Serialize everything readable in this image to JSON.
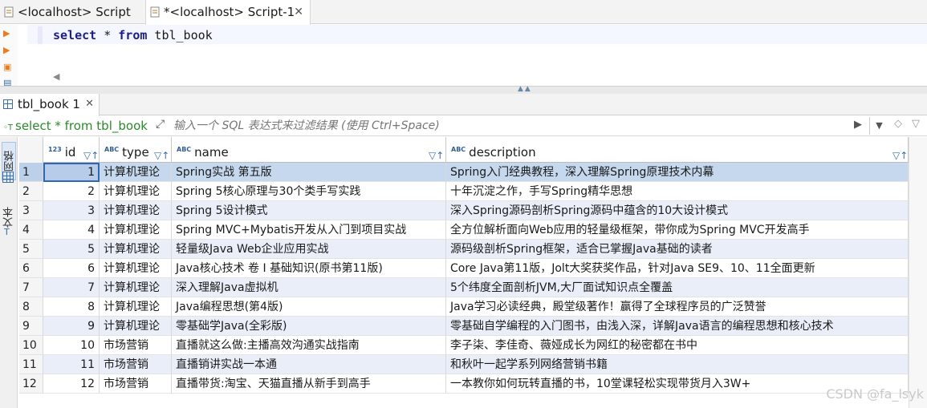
{
  "editor_tabs": [
    {
      "label": "<localhost> Script"
    },
    {
      "label": "*<localhost> Script-1",
      "close": "✕"
    }
  ],
  "editor": {
    "keyword_select": "select",
    "star": " * ",
    "keyword_from": "from",
    "table": " tbl_book"
  },
  "result_tab": {
    "label": "tbl_book 1",
    "close": "✕"
  },
  "filter": {
    "query": "select * from tbl_book",
    "placeholder": "输入一个 SQL 表达式来过滤结果 (使用 Ctrl+Space)"
  },
  "side_panel": {
    "grid_label": "网格",
    "text_label": "文本"
  },
  "columns": [
    {
      "label": "id",
      "type_icon": "123"
    },
    {
      "label": "type",
      "type_icon": "ABC"
    },
    {
      "label": "name",
      "type_icon": "ABC"
    },
    {
      "label": "description",
      "type_icon": "ABC"
    }
  ],
  "rows": [
    {
      "rn": "1",
      "id": "1",
      "type": "计算机理论",
      "name": "Spring实战 第五版",
      "description": "Spring入门经典教程，深入理解Spring原理技术内幕"
    },
    {
      "rn": "2",
      "id": "2",
      "type": "计算机理论",
      "name": "Spring 5核心原理与30个类手写实践",
      "description": "十年沉淀之作，手写Spring精华思想"
    },
    {
      "rn": "3",
      "id": "3",
      "type": "计算机理论",
      "name": "Spring 5设计模式",
      "description": "深入Spring源码剖析Spring源码中蕴含的10大设计模式"
    },
    {
      "rn": "4",
      "id": "4",
      "type": "计算机理论",
      "name": "Spring MVC+Mybatis开发从入门到项目实战",
      "description": "全方位解析面向Web应用的轻量级框架，带你成为Spring MVC开发高手"
    },
    {
      "rn": "5",
      "id": "5",
      "type": "计算机理论",
      "name": "轻量级Java Web企业应用实战",
      "description": "源码级剖析Spring框架，适合已掌握Java基础的读者"
    },
    {
      "rn": "6",
      "id": "6",
      "type": "计算机理论",
      "name": "Java核心技术 卷 I  基础知识(原书第11版)",
      "description": "Core Java第11版，Jolt大奖获奖作品，针对Java SE9、10、11全面更新"
    },
    {
      "rn": "7",
      "id": "7",
      "type": "计算机理论",
      "name": "深入理解Java虚拟机",
      "description": "5个纬度全面剖析JVM,大厂面试知识点全覆盖"
    },
    {
      "rn": "8",
      "id": "8",
      "type": "计算机理论",
      "name": "Java编程思想(第4版)",
      "description": "Java学习必读经典，殿堂级著作！赢得了全球程序员的广泛赞誉"
    },
    {
      "rn": "9",
      "id": "9",
      "type": "计算机理论",
      "name": "零基础学Java(全彩版)",
      "description": "零基础自学编程的入门图书，由浅入深，详解Java语言的编程思想和核心技术"
    },
    {
      "rn": "10",
      "id": "10",
      "type": "市场营销",
      "name": "直播就这么做:主播高效沟通实战指南",
      "description": "李子柒、李佳奇、薇娅成长为网红的秘密都在书中"
    },
    {
      "rn": "11",
      "id": "11",
      "type": "市场营销",
      "name": "直播销讲实战一本通",
      "description": "和秋叶一起学系列网络营销书籍"
    },
    {
      "rn": "12",
      "id": "12",
      "type": "市场营销",
      "name": "直播带货:淘宝、天猫直播从新手到高手",
      "description": "一本教你如何玩转直播的书，10堂课轻松实现带货月入3W+"
    }
  ],
  "watermark": "CSDN @fa_lsyk",
  "colors": {
    "keyword": "#1d1d8a",
    "filter_query": "#2a8a2a",
    "row_alt": "#e9eef8",
    "row_selected": "#c5d8ee"
  }
}
